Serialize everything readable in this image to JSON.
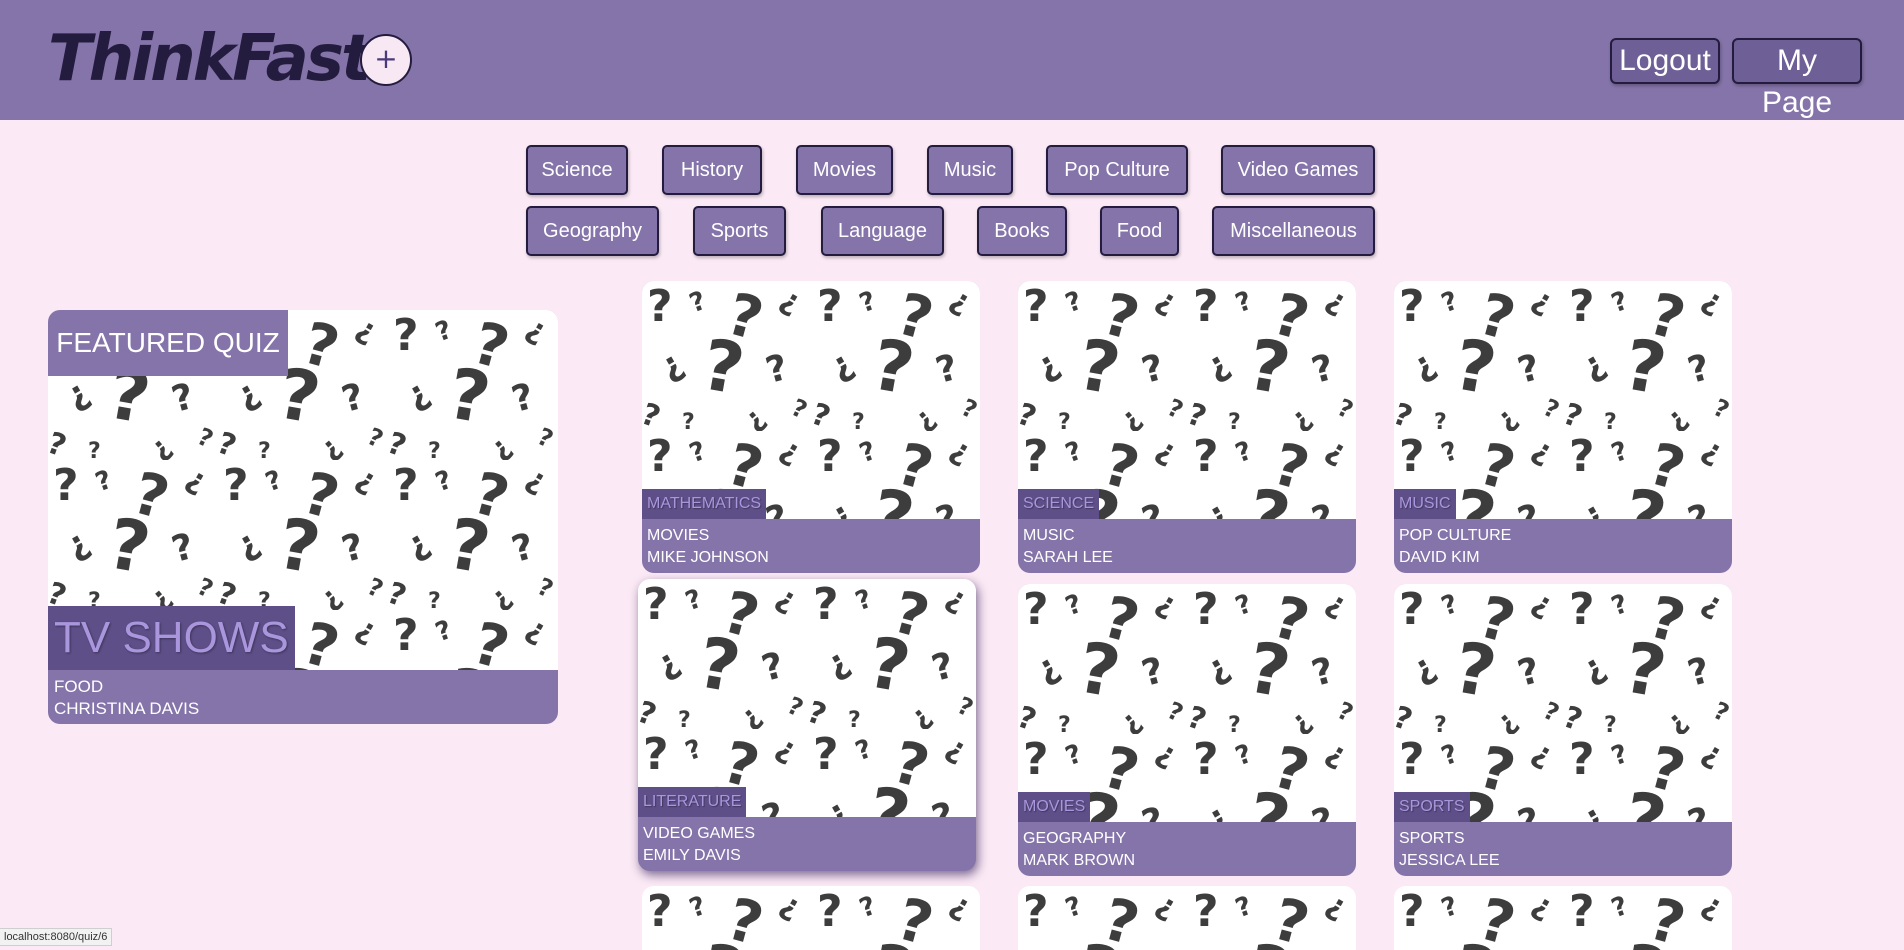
{
  "header": {
    "logo": "ThinkFast",
    "add_label": "+",
    "logout_label": "Logout",
    "mypage_label": "My Page"
  },
  "categories": [
    "Science",
    "History",
    "Movies",
    "Music",
    "Pop Culture",
    "Video Games",
    "Geography",
    "Sports",
    "Language",
    "Books",
    "Food",
    "Miscellaneous"
  ],
  "featured": {
    "label": "FEATURED QUIZ",
    "title": "TV SHOWS",
    "category": "FOOD",
    "author": "CHRISTINA DAVIS"
  },
  "quizzes": [
    {
      "tag": "MATHEMATICS",
      "category": "MOVIES",
      "author": "MIKE JOHNSON"
    },
    {
      "tag": "SCIENCE",
      "category": "MUSIC",
      "author": "SARAH LEE"
    },
    {
      "tag": "MUSIC",
      "category": "POP CULTURE",
      "author": "DAVID KIM"
    },
    {
      "tag": "LITERATURE",
      "category": "VIDEO GAMES",
      "author": "EMILY DAVIS"
    },
    {
      "tag": "MOVIES",
      "category": "GEOGRAPHY",
      "author": "MARK BROWN"
    },
    {
      "tag": "SPORTS",
      "category": "SPORTS",
      "author": "JESSICA LEE"
    }
  ],
  "status_url": "localhost:8080/quiz/6",
  "colors": {
    "accent": "#8574aa",
    "background": "#fbe9f5",
    "dark": "#241c3e"
  }
}
